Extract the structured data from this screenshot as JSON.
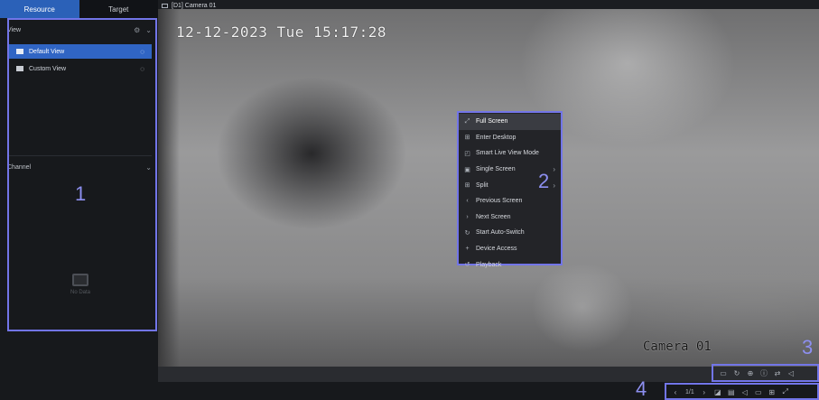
{
  "tabs": {
    "resource": "Resource",
    "target": "Target"
  },
  "view": {
    "title": "View",
    "items": [
      {
        "label": "Default View",
        "selected": true
      },
      {
        "label": "Custom View",
        "selected": false
      }
    ]
  },
  "channel": {
    "title": "Channel",
    "empty_text": "No Data"
  },
  "camera_title": "[D1] Camera 01",
  "osd": {
    "datetime": "12-12-2023 Tue 15:17:28",
    "camera_name": "Camera 01"
  },
  "context_menu": [
    {
      "label": "Full Screen",
      "icon": "fullscreen-icon",
      "glyph": "⤢",
      "hover": true,
      "submenu": false
    },
    {
      "label": "Enter Desktop",
      "icon": "desktop-icon",
      "glyph": "⊞",
      "hover": false,
      "submenu": false
    },
    {
      "label": "Smart Live View Mode",
      "icon": "smart-view-icon",
      "glyph": "◰",
      "hover": false,
      "submenu": false
    },
    {
      "label": "Single Screen",
      "icon": "single-screen-icon",
      "glyph": "▣",
      "hover": false,
      "submenu": true
    },
    {
      "label": "Split",
      "icon": "split-icon",
      "glyph": "⊞",
      "hover": false,
      "submenu": true
    },
    {
      "label": "Previous Screen",
      "icon": "previous-icon",
      "glyph": "‹",
      "hover": false,
      "submenu": false
    },
    {
      "label": "Next Screen",
      "icon": "next-icon",
      "glyph": "›",
      "hover": false,
      "submenu": false
    },
    {
      "label": "Start Auto-Switch",
      "icon": "auto-switch-icon",
      "glyph": "↻",
      "hover": false,
      "submenu": false
    },
    {
      "label": "Device Access",
      "icon": "device-access-icon",
      "glyph": "+",
      "hover": false,
      "submenu": false
    },
    {
      "label": "Playback",
      "icon": "playback-icon",
      "glyph": "↺",
      "hover": false,
      "submenu": false
    }
  ],
  "annotations": [
    "1",
    "2",
    "3",
    "4"
  ],
  "bottom_bar": {
    "page": "1/1"
  },
  "colors": {
    "accent": "#3065c4",
    "annotation": "#7275e8"
  }
}
